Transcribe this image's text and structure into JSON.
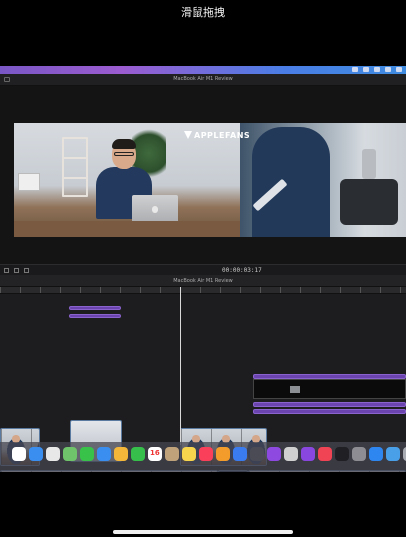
{
  "overlay": {
    "caption": "滑鼠拖拽"
  },
  "window": {
    "title": "MacBook Air M1 Review"
  },
  "viewer": {
    "brand": "APPLEFANS",
    "subtitle": "",
    "timecode": "00:00:03:17"
  },
  "timeline": {
    "project_title": "MacBook Air M1 Review",
    "clips": [
      {
        "label": "",
        "kind": "title"
      },
      {
        "label": "",
        "kind": "title"
      },
      {
        "label": "",
        "kind": "title"
      },
      {
        "label": "",
        "kind": "title"
      },
      {
        "label": "",
        "kind": "title"
      },
      {
        "label": "",
        "kind": "video"
      },
      {
        "label": "",
        "kind": "video"
      },
      {
        "label": "",
        "kind": "video"
      },
      {
        "label": "",
        "kind": "video"
      },
      {
        "label": "",
        "kind": "video"
      },
      {
        "label": "",
        "kind": "video"
      }
    ]
  },
  "colors": {
    "accent": "#6b44b0",
    "video_clip": "#2f4460",
    "menubar_left": "#7a57c6",
    "menubar_right": "#3e8be0"
  },
  "dock": {
    "apps": [
      {
        "name": "reminders-icon",
        "color": "#ffffff"
      },
      {
        "name": "safari-icon",
        "color": "#3a8ef0"
      },
      {
        "name": "chrome-icon",
        "color": "#e8e8e8"
      },
      {
        "name": "maps-icon",
        "color": "#6fc36a"
      },
      {
        "name": "messages-icon",
        "color": "#39c24a"
      },
      {
        "name": "mail-icon",
        "color": "#3a8ef0"
      },
      {
        "name": "photos-icon",
        "color": "#f4b73a"
      },
      {
        "name": "facetime-icon",
        "color": "#36c04b"
      },
      {
        "name": "calendar-icon",
        "color": "#ffffff",
        "badge": "16"
      },
      {
        "name": "contacts-icon",
        "color": "#bfa27a"
      },
      {
        "name": "notes-icon",
        "color": "#f7d54d"
      },
      {
        "name": "music-icon",
        "color": "#fa3f5a"
      },
      {
        "name": "pages-icon",
        "color": "#f39c2c"
      },
      {
        "name": "keynote-icon",
        "color": "#3a7cf0"
      },
      {
        "name": "finalcut-icon",
        "color": "#4b4b55"
      },
      {
        "name": "motion-icon",
        "color": "#8e4ae0"
      },
      {
        "name": "compressor-icon",
        "color": "#d0d0d0"
      },
      {
        "name": "podcasts-icon",
        "color": "#8a47e0"
      },
      {
        "name": "news-icon",
        "color": "#f04455"
      },
      {
        "name": "tv-icon",
        "color": "#1f1f24"
      },
      {
        "name": "systemprefs-icon",
        "color": "#8d8d93"
      },
      {
        "name": "appstore-icon",
        "color": "#2e86f0"
      },
      {
        "name": "preview-icon",
        "color": "#4aa0e8"
      },
      {
        "name": "trash-icon",
        "color": "#a9acb3"
      }
    ]
  }
}
